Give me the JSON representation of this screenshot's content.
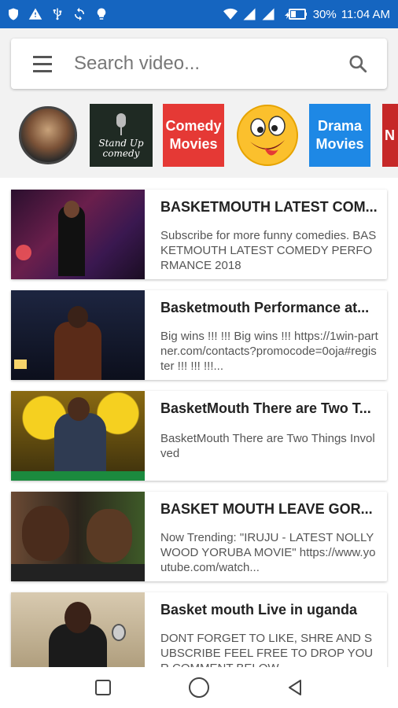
{
  "status_bar": {
    "battery": "30%",
    "time": "11:04 AM"
  },
  "search": {
    "placeholder": "Search video..."
  },
  "categories": {
    "standup_label": "Stand Up comedy",
    "comedy_label": "Comedy Movies",
    "drama_label": "Drama Movies",
    "partial_label": "N"
  },
  "videos": [
    {
      "title": "BASKETMOUTH LATEST COM...",
      "description": "Subscribe for more funny comedies. BASKETMOUTH LATEST COMEDY PERFORMANCE 2018"
    },
    {
      "title": "Basketmouth Performance at...",
      "description": "Big wins !!! !!! Big wins !!! https://1win-partner.com/contacts?promocode=0oja#register !!! !!! !!!..."
    },
    {
      "title": "BasketMouth There are Two T...",
      "description": "BasketMouth There are Two Things Involved"
    },
    {
      "title": "BASKET MOUTH LEAVE GOR...",
      "description": "Now Trending: \"IRUJU - LATEST NOLLYWOOD YORUBA MOVIE\" https://www.youtube.com/watch..."
    },
    {
      "title": "Basket mouth Live in uganda",
      "description": "DONT FORGET TO LIKE, SHRE AND SUBSCRIBE FEEL FREE TO DROP YOUR COMMENT BELOW"
    }
  ],
  "colors": {
    "status_bar": "#1565c0",
    "comedy_tile": "#e53935",
    "drama_tile": "#1e88e5"
  }
}
